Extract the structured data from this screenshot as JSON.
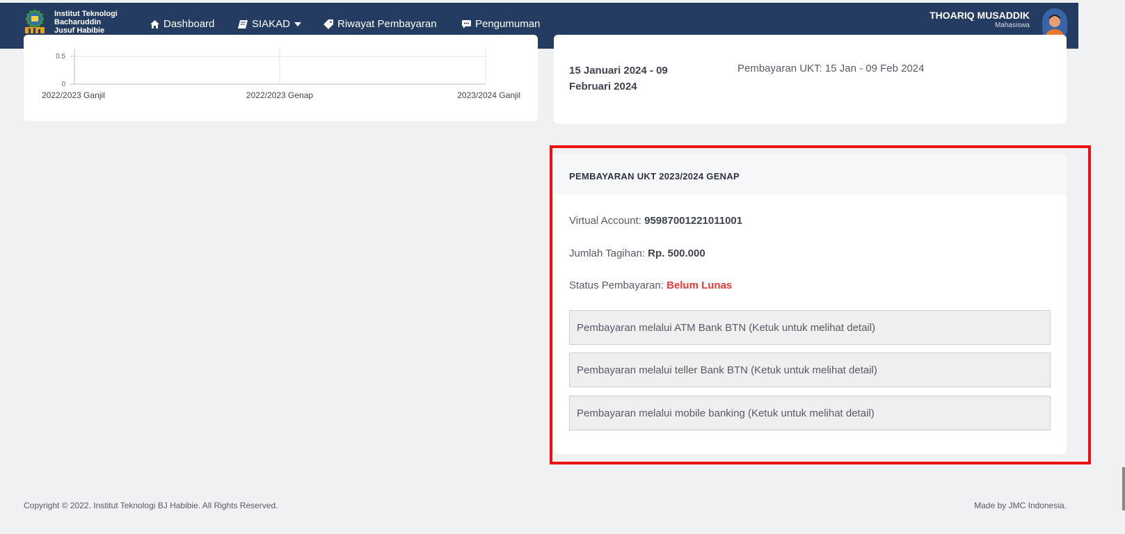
{
  "nav": {
    "brand_lines": [
      "Institut Teknologi",
      "Bacharuddin",
      "Jusuf Habibie"
    ],
    "items": [
      {
        "label": "Dashboard",
        "icon": "home-icon"
      },
      {
        "label": "SIAKAD",
        "icon": "book-icon",
        "dropdown": true
      },
      {
        "label": "Riwayat Pembayaran",
        "icon": "tag-icon"
      },
      {
        "label": "Pengumuman",
        "icon": "message-icon"
      }
    ],
    "user_name": "THOARIQ MUSADDIK",
    "user_role": "Mahasiswa"
  },
  "chart_data": {
    "type": "line",
    "categories": [
      "2022/2023 Ganjil",
      "2022/2023 Genap",
      "2023/2024 Ganjil"
    ],
    "y_ticks_visible": [
      "0.5",
      "0"
    ],
    "grid": true
  },
  "schedule": {
    "date_range": "15 Januari 2024 - 09 Februari 2024",
    "description": "Pembayaran UKT: 15 Jan - 09 Feb 2024"
  },
  "payment": {
    "title": "PEMBAYARAN UKT 2023/2024 GENAP",
    "va_label": "Virtual Account: ",
    "va_value": "95987001221011001",
    "amount_label": "Jumlah Tagihan: ",
    "amount_value": "Rp. 500.000",
    "status_label": "Status Pembayaran: ",
    "status_value": "Belum Lunas",
    "status_color": "#e53935",
    "options": [
      "Pembayaran melalui ATM Bank BTN (Ketuk untuk melihat detail)",
      "Pembayaran melalui teller Bank BTN (Ketuk untuk melihat detail)",
      "Pembayaran melalui mobile banking (Ketuk untuk melihat detail)"
    ]
  },
  "footer": {
    "copyright": "Copyright © 2022. Institut Teknologi BJ Habibie. All Rights Reserved.",
    "made_by": "Made by JMC Indonesia."
  },
  "colors": {
    "navbar": "#243c61",
    "highlight": "#ee1111"
  }
}
